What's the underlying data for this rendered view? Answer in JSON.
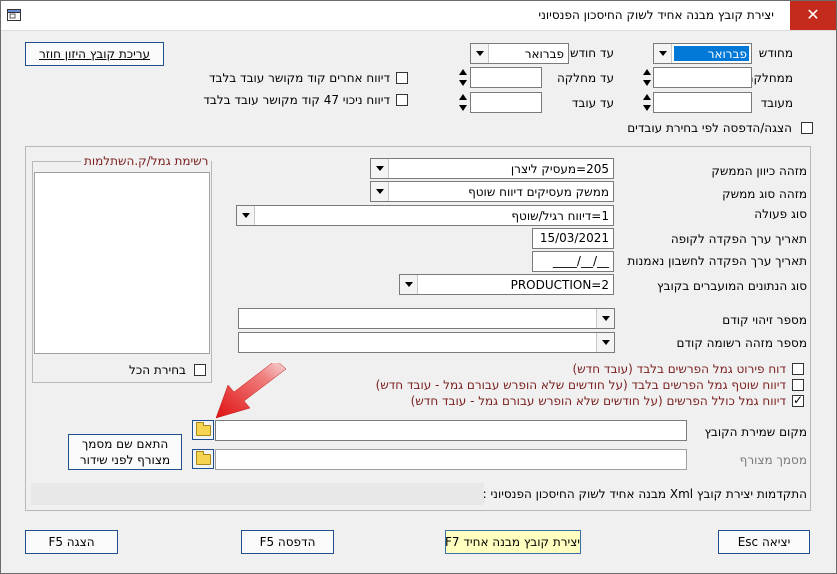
{
  "window": {
    "title": "יצירת קובץ מבנה אחיד לשוק החיסכון הפנסיוני",
    "close_label": "✕"
  },
  "top": {
    "from_month_label": "מחודש",
    "from_month_value": "פברואר",
    "to_month_label": "עד חודש",
    "to_month_value": "פברואר",
    "edit_return_button": "עריכת קובץ היזון חוזר",
    "from_dept_label": "ממחלקה",
    "to_dept_label": "עד מחלקה",
    "from_emp_label": "מעובד",
    "to_emp_label": "עד עובד",
    "other_reports_label": "דיווח אחרים קוד מקושר עובד בלבד",
    "deduction_report_label": "דיווח ניכוי 47 קוד מקושר עובד בלבד",
    "show_print_by_selection_label": "הצגה/הדפסה לפי בחירת עובדים"
  },
  "group": {
    "legend": "רשימת גמל/ק.השתלמות",
    "select_all_label": "בחירת הכל"
  },
  "form": {
    "employer_id_label": "מזהה כיוון הממשק",
    "employer_id_value": "205=מעסיק ליצרן",
    "interface_type_label": "מזהה סוג ממשק",
    "interface_type_value": "ממשק מעסיקים דיווח שוטף",
    "action_type_label": "סוג פעולה",
    "action_type_value": "1=דיווח רגיל/שוטף",
    "deposit_value_date_label": "תאריך ערך הפקדה לקופה",
    "deposit_value_date_value": "15/03/2021",
    "trustee_deposit_date_label": "תאריך ערך הפקדה לחשבון נאמנות",
    "trustee_deposit_date_value": "__/__/____",
    "data_type_label": "סוג הנתונים המועברים בקובץ",
    "data_type_value": "PRODUCTION=2",
    "prev_id_label": "מספר זיהוי קודם",
    "prev_record_id_label": "מספר מזהה רשומה קודם"
  },
  "options": {
    "opt1_label": "דוח פירוט גמל הפרשים בלבד (עובד חדש)",
    "opt2_label": "דיווח שוטף גמל הפרשים בלבד (על חודשים שלא הופרש עבורם גמל - עובד חדש)",
    "opt3_label": "דיווח גמל כולל הפרשים (על חודשים שלא הופרש עבורם גמל - עובד חדש)"
  },
  "file": {
    "save_location_label": "מקום שמירת הקובץ",
    "attached_doc_label": "מסמך מצורף",
    "match_doc_button_line1": "התאם שם מסמך",
    "match_doc_button_line2": "מצורף לפני שידור"
  },
  "progress": {
    "label": "התקדמות יצירת קובץ Xml מבנה אחיד לשוק החיסכון הפנסיוני :"
  },
  "footer": {
    "exit_button": "יציאה Esc",
    "create_button": "יצירת קובץ מבנה אחיד F7",
    "print_button": "הדפסה F5",
    "show_button": "הצגה F5"
  },
  "checks": {
    "opt1": false,
    "opt2": false,
    "opt3": true,
    "other_reports": false,
    "deduction_report": false,
    "show_print": false,
    "select_all": false
  },
  "colors": {
    "accent": "#0078d7",
    "close": "#c42b1c",
    "maroon": "#7a1f1f",
    "arrow": "#e02020",
    "yellow_button": "#ffffc0"
  },
  "icons": {
    "app": "app-window-icon",
    "folder": "folder-open-icon",
    "arrow": "red-pointer-arrow-icon"
  }
}
